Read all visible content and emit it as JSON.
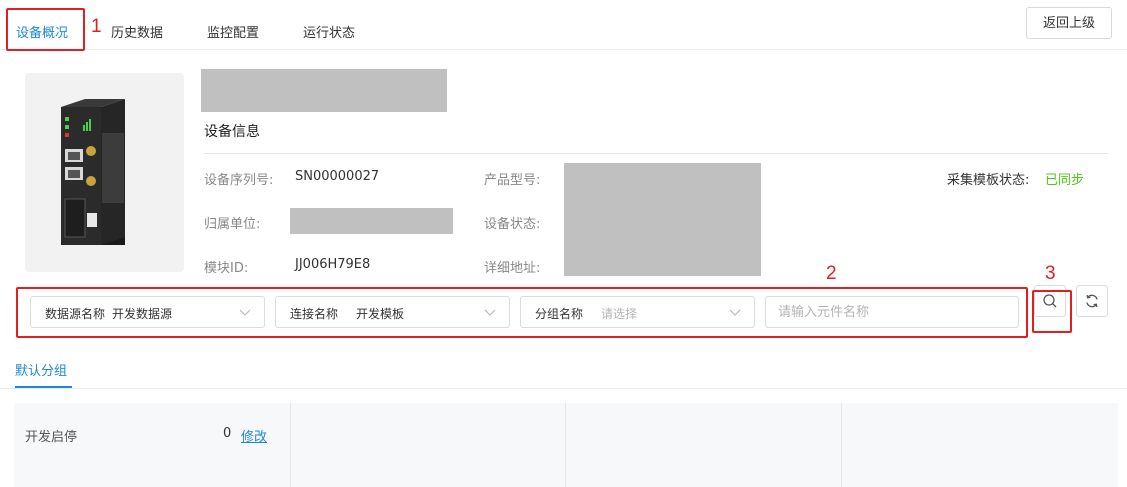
{
  "tabs": [
    {
      "label": "设备概况",
      "active": true
    },
    {
      "label": "历史数据",
      "active": false
    },
    {
      "label": "监控配置",
      "active": false
    },
    {
      "label": "运行状态",
      "active": false
    }
  ],
  "annotations": [
    "1",
    "2",
    "3"
  ],
  "back_button": "返回上级",
  "device": {
    "image_icon": "industrial-router-device",
    "section_title": "设备信息",
    "serial_label": "设备序列号:",
    "serial_value": "SN00000027",
    "org_label": "归属单位:",
    "module_label": "模块ID:",
    "module_value": "JJ006H79E8",
    "model_label": "产品型号:",
    "status_label": "设备状态:",
    "address_label": "详细地址:",
    "template_status_label": "采集模板状态:",
    "template_status_value": "已同步",
    "template_status_color": "#52c41a"
  },
  "filters": {
    "datasource_label": "数据源名称",
    "datasource_value": "开发数据源",
    "connection_label": "连接名称",
    "connection_value": "开发模板",
    "group_label": "分组名称",
    "group_placeholder": "请选择",
    "element_placeholder": "请输入元件名称",
    "search_icon": "search-icon",
    "refresh_icon": "refresh-icon"
  },
  "group_tab": "默认分组",
  "cards": [
    {
      "name": "开发启停",
      "count": "0",
      "edit_label": "修改"
    }
  ],
  "colors": {
    "accent": "#1e88d4",
    "annotation_red": "#e02020",
    "redacted_gray": "#c0c0c0"
  }
}
